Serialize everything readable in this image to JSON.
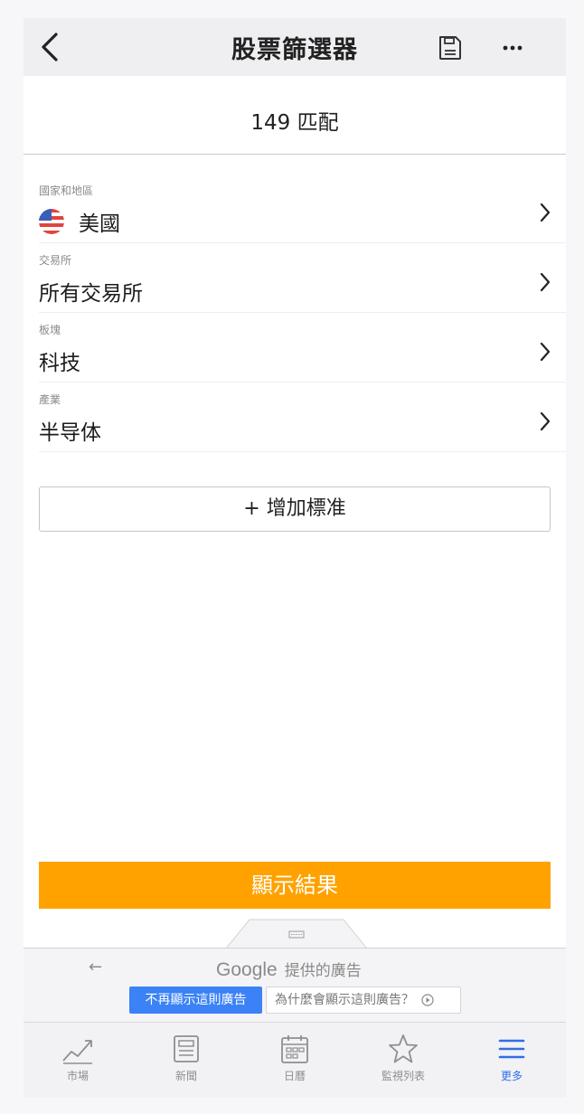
{
  "header": {
    "title": "股票篩選器"
  },
  "match_text": "149 匹配",
  "filters": [
    {
      "label": "國家和地區",
      "value": "美國"
    },
    {
      "label": "交易所",
      "value": "所有交易所"
    },
    {
      "label": "板塊",
      "value": "科技"
    },
    {
      "label": "產業",
      "value": "半导体"
    }
  ],
  "add_criteria_label": "+ 增加標准",
  "show_results_label": "顯示結果",
  "ad": {
    "google": "Google",
    "provided": "提供的廣告",
    "stop_label": "不再顯示這則廣告",
    "why_label": "為什麼會顯示這則廣告？"
  },
  "tabs": [
    {
      "label": "市場",
      "icon": "trend-chart-icon"
    },
    {
      "label": "新聞",
      "icon": "newspaper-icon"
    },
    {
      "label": "日曆",
      "icon": "calendar-icon"
    },
    {
      "label": "監視列表",
      "icon": "star-icon"
    },
    {
      "label": "更多",
      "icon": "menu-icon"
    }
  ],
  "colors": {
    "accent_orange": "#ffa200",
    "tab_active": "#2f6ee8",
    "ad_button_blue": "#3b82f6"
  }
}
